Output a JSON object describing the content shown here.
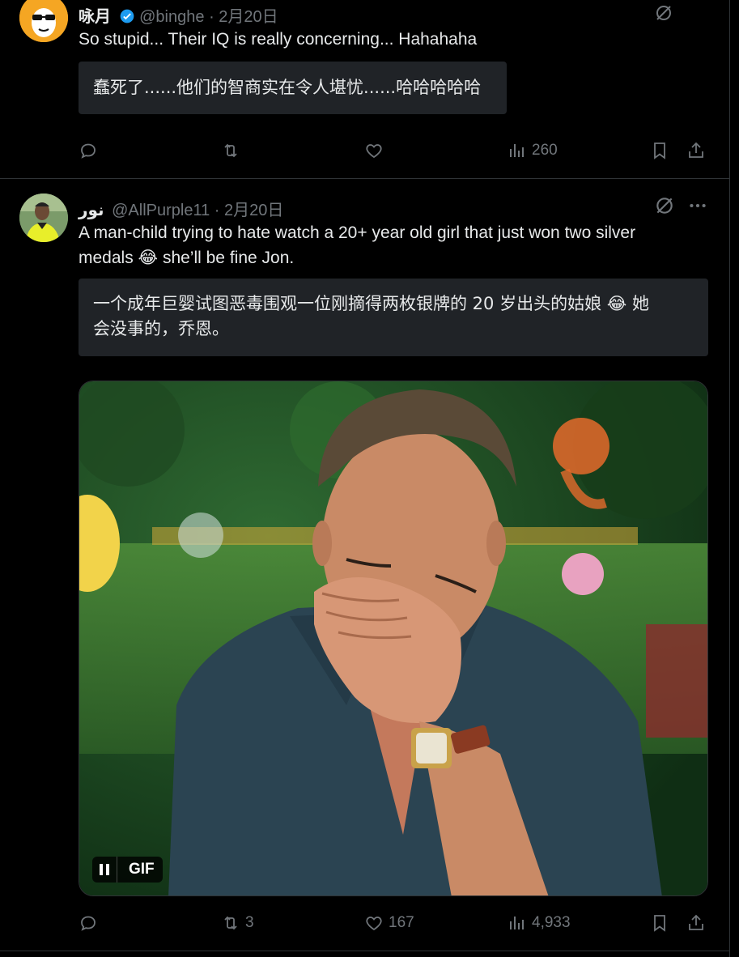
{
  "tweet1": {
    "display_name": "咏月",
    "handle": "@binghe",
    "date": "· 2月20日",
    "text": "So stupid... Their IQ is really concerning... Hahahaha",
    "translation": "蠢死了......他们的智商实在令人堪忧......哈哈哈哈哈",
    "stats": {
      "views": "260"
    }
  },
  "tweet2": {
    "display_name": "نور",
    "handle": "@AllPurple11",
    "date": "· 2月20日",
    "text_line1": "A man-child trying to hate watch a 20+ year old girl that just won two silver",
    "text_line2_a": "medals",
    "text_line2_b": "she’ll be fine Jon.",
    "emoji": "😂",
    "translation_line1_a": "一个成年巨婴试图恶毒围观一位刚摘得两枚银牌的 20 岁出头的姑娘",
    "translation_line1_b": "她",
    "translation_line2": "会没事的，乔恩。",
    "media_badge": "GIF",
    "stats": {
      "retweets": "3",
      "likes": "167",
      "views": "4,933"
    }
  },
  "colors": {
    "background": "#000000",
    "text": "#e7e9ea",
    "muted": "#71767b",
    "verified": "#1d9bf0",
    "box": "#202327"
  },
  "icons": [
    "reply-icon",
    "retweet-icon",
    "like-icon",
    "views-icon",
    "bookmark-icon",
    "share-icon",
    "grok-icon",
    "more-icon",
    "verified-icon",
    "pause-icon"
  ]
}
